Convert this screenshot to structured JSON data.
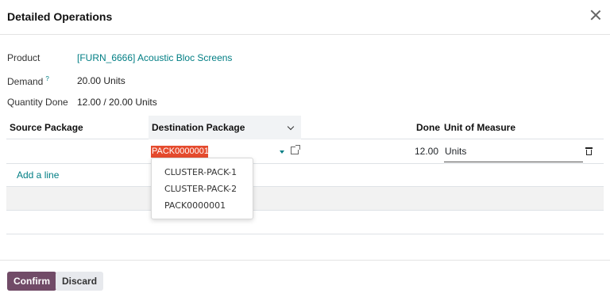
{
  "dialog": {
    "title": "Detailed Operations"
  },
  "fields": {
    "product_label": "Product",
    "product_value": "[FURN_6666] Acoustic Bloc Screens",
    "demand_label": "Demand",
    "demand_help": "?",
    "demand_value": "20.00 Units",
    "qty_done_label": "Quantity Done",
    "qty_done_value": "12.00 / 20.00 Units"
  },
  "table": {
    "columns": [
      "Source Package",
      "Destination Package",
      "Done",
      "Unit of Measure"
    ],
    "rows": [
      {
        "source_package": "",
        "destination_package": "PACK0000001",
        "done": "12.00",
        "uom": "Units"
      }
    ],
    "add_line_label": "Add a line"
  },
  "dropdown": {
    "options": [
      "CLUSTER-PACK-1",
      "CLUSTER-PACK-2",
      "PACK0000001"
    ]
  },
  "footer": {
    "confirm_label": "Confirm",
    "discard_label": "Discard"
  },
  "colors": {
    "primary": "#714b67",
    "link": "#017e84",
    "highlight": "#e54b2e"
  },
  "icons": [
    "close-icon",
    "chevron-down-icon",
    "caret-down-icon",
    "external-link-icon",
    "trash-icon"
  ]
}
